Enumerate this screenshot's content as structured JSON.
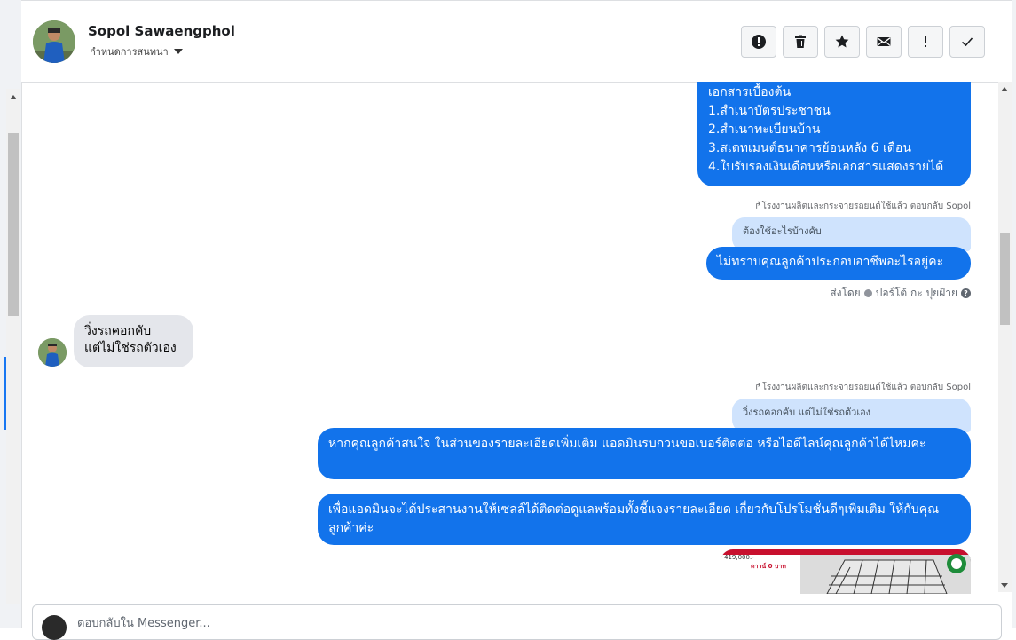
{
  "header": {
    "contact_name": "Sopol Sawaengphol",
    "assign_label": "กำหนดการสนทนา"
  },
  "actions": [
    {
      "name": "spam",
      "icon": "alert-circle-icon"
    },
    {
      "name": "delete",
      "icon": "trash-icon"
    },
    {
      "name": "star",
      "icon": "star-icon"
    },
    {
      "name": "mark-unread",
      "icon": "envelope-icon"
    },
    {
      "name": "follow-up",
      "icon": "exclamation-icon"
    },
    {
      "name": "done",
      "icon": "check-icon"
    }
  ],
  "messages": {
    "docs_list": [
      "เอกสารเบื้องต้น",
      "1.สำเนาบัตรประชาชน",
      "2.สำเนาทะเบียนบ้าน",
      "3.สเตทเมนต์ธนาคารย้อนหลัง 6 เดือน",
      "4.ใบรับรองเงินเดือนหรือเอกสารแสดงรายได้"
    ],
    "reply_note_1": "โรงงานผลิตและกระจายรถยนต์ใช้แล้ว ตอบกลับ Sopol",
    "quoted_1": "ต้องใช้อะไรบ้างคับ",
    "occupation_question": "ไม่ทราบคุณลูกค้าประกอบอาชีพอะไรอยู่คะ",
    "sent_by_label": "ส่งโดย",
    "sent_by_name": "ปอร์โต้ กะ ปุยฝ้าย",
    "incoming_line1": "วิ่งรถคอกคับ",
    "incoming_line2": "แต่ไม่ใช่รถตัวเอง",
    "reply_note_2": "โรงงานผลิตและกระจายรถยนต์ใช้แล้ว ตอบกลับ Sopol",
    "quoted_2": "วิ่งรถคอกคับ แต่ไม่ใช่รถตัวเอง",
    "ask_phone": "หากคุณลูกค้าสนใจ ในส่วนของรายละเอียดเพิ่มเติม แอดมินรบกวนขอเบอร์ติดต่อ หรือไอดีไลน์คุณลูกค้าได้ไหมคะ",
    "coordinate": "เพื่อแอดมินจะได้ประสานงานให้เซลล์ได้ติดต่อดูแลพร้อมทั้งชี้แจงรายละเอียด เกี่ยวกับโปรโมชั่นดีๆเพิ่มเติม ให้กับคุณลูกค้าค่ะ"
  },
  "promo_image": {
    "price_text": "419,000.-",
    "promo_text": "ดาวน์ 0 บาท"
  },
  "composer": {
    "placeholder": "ตอบกลับใน Messenger..."
  },
  "colors": {
    "outgoing_bubble": "#1273eb",
    "incoming_bubble": "#e4e6eb",
    "quoted_bubble": "#cfe3fd"
  }
}
